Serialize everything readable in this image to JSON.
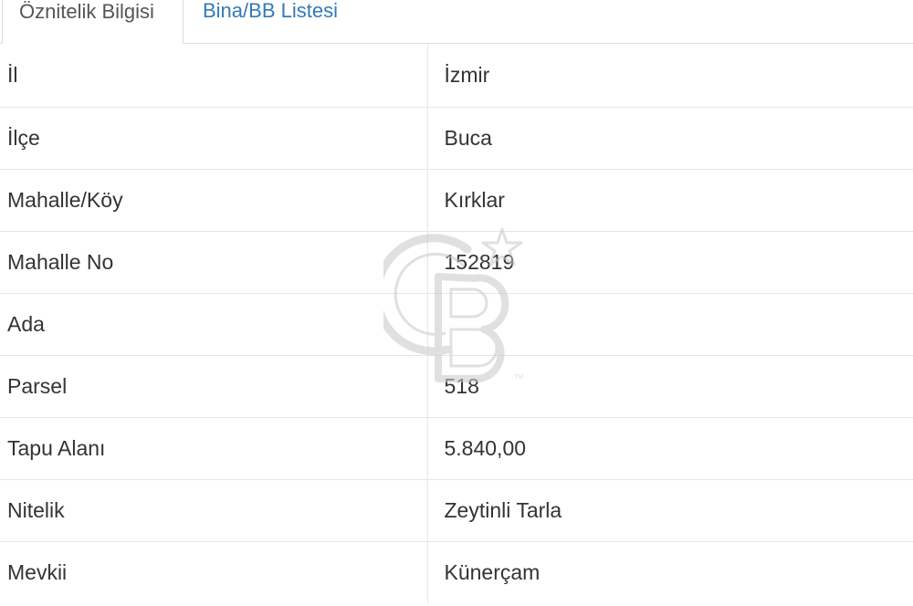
{
  "tabs": [
    {
      "label": "Öznitelik Bilgisi",
      "active": true
    },
    {
      "label": "Bina/BB Listesi",
      "active": false
    }
  ],
  "rows": [
    {
      "key": "İl",
      "value": "İzmir"
    },
    {
      "key": "İlçe",
      "value": "Buca"
    },
    {
      "key": "Mahalle/Köy",
      "value": "Kırklar"
    },
    {
      "key": "Mahalle No",
      "value": "152819"
    },
    {
      "key": "Ada",
      "value": ""
    },
    {
      "key": "Parsel",
      "value": "518"
    },
    {
      "key": "Tapu Alanı",
      "value": "5.840,00"
    },
    {
      "key": "Nitelik",
      "value": "Zeytinli Tarla"
    },
    {
      "key": "Mevkii",
      "value": "Künerçam"
    }
  ],
  "colors": {
    "tab_link": "#337ab7",
    "border": "#dddddd",
    "text": "#333333",
    "watermark": "#bfbfbf"
  },
  "watermark": {
    "icon": "cb-logo-icon",
    "text": "CB",
    "mark": "TM"
  }
}
